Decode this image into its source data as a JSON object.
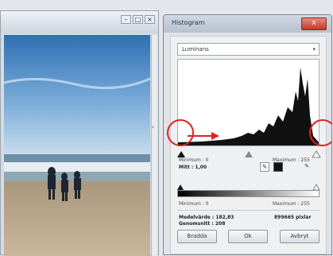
{
  "image_window": {
    "buttons": [
      "–",
      "□",
      "×"
    ]
  },
  "histogram_dialog": {
    "title": "Histogram",
    "close_label": "x",
    "channel": "Luminans",
    "input_min_label": "Minimum : 0",
    "input_max_label": "Maximum : 255",
    "mid_label": "Mitt : 1,00",
    "output_min_label": "Minimum : 0",
    "output_max_label": "Maximum : 255",
    "median_label": "Medelvärde : 182,83",
    "pixels_label": "899665 pixlar",
    "average_label": "Genomsnitt : 208",
    "buttons": {
      "reset": "Bradda",
      "ok": "Ok",
      "cancel": "Avbryt"
    }
  },
  "colors": {
    "annotation_red": "#e02020",
    "arrow_red": "#e02020"
  }
}
